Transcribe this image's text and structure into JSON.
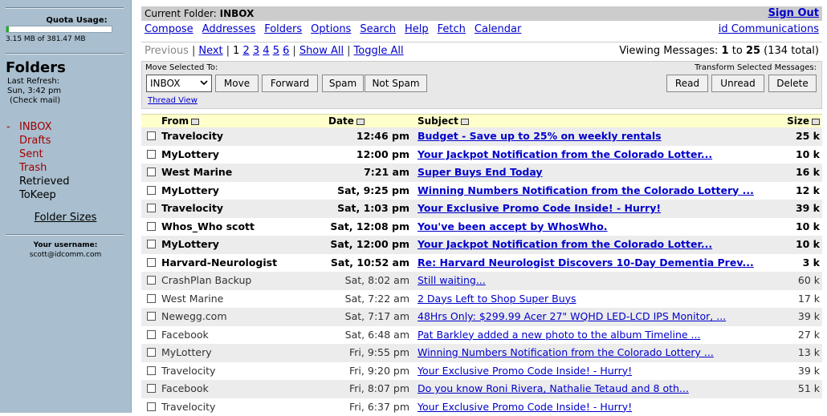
{
  "sidebar": {
    "quota_title": "Quota Usage:",
    "quota_text": "3.15 MB of 381.47 MB",
    "quota_fraction": 0.008,
    "folders_title": "Folders",
    "refresh_label": "Last Refresh:",
    "refresh_time": "Sun, 3:42 pm",
    "check_mail": "(Check mail)",
    "folders": [
      "INBOX",
      "Drafts",
      "Sent",
      "Trash",
      "Retrieved",
      "ToKeep"
    ],
    "folder_sizes": "Folder Sizes",
    "user_label": "Your username:",
    "user_email": "scott@idcomm.com"
  },
  "header": {
    "current_folder_label": "Current Folder:",
    "current_folder": "INBOX",
    "sign_out": "Sign Out"
  },
  "nav": {
    "items": [
      "Compose",
      "Addresses",
      "Folders",
      "Options",
      "Search",
      "Help",
      "Fetch",
      "Calendar"
    ],
    "org": "id Communications"
  },
  "pager": {
    "previous": "Previous",
    "next": "Next",
    "current_page": "1",
    "pages": [
      "2",
      "3",
      "4",
      "5",
      "6"
    ],
    "show_all": "Show All",
    "toggle_all": "Toggle All",
    "viewing_prefix": "Viewing Messages:",
    "viewing_from": "1",
    "viewing_to_word": "to",
    "viewing_to": "25",
    "viewing_total": "(134 total)"
  },
  "actions": {
    "move_label": "Move Selected To:",
    "transform_label": "Transform Selected Messages:",
    "selected_folder": "INBOX",
    "move": "Move",
    "forward": "Forward",
    "spam": "Spam",
    "not_spam": "Not Spam",
    "read": "Read",
    "unread": "Unread",
    "delete": "Delete",
    "thread_view": "Thread View"
  },
  "table": {
    "headers": {
      "from": "From",
      "date": "Date",
      "subject": "Subject",
      "size": "Size"
    },
    "rows": [
      {
        "from": "Travelocity",
        "date": "12:46 pm",
        "subject": "Budget - Save up to 25% on weekly rentals",
        "size": "25 k",
        "unread": true
      },
      {
        "from": "MyLottery",
        "date": "12:00 pm",
        "subject": "Your Jackpot Notification from the Colorado Lotter...",
        "size": "10 k",
        "unread": true
      },
      {
        "from": "West Marine",
        "date": "7:21 am",
        "subject": "Super Buys End Today",
        "size": "16 k",
        "unread": true
      },
      {
        "from": "MyLottery",
        "date": "Sat, 9:25 pm",
        "subject": "Winning Numbers Notification from the Colorado Lottery ...",
        "size": "12 k",
        "unread": true
      },
      {
        "from": "Travelocity",
        "date": "Sat, 1:03 pm",
        "subject": "Your Exclusive Promo Code Inside! - Hurry!",
        "size": "39 k",
        "unread": true
      },
      {
        "from": "Whos_Who scott",
        "date": "Sat, 12:08 pm",
        "subject": "You've been accept by WhosWho.",
        "size": "10 k",
        "unread": true
      },
      {
        "from": "MyLottery",
        "date": "Sat, 12:00 pm",
        "subject": "Your Jackpot Notification from the Colorado Lotter...",
        "size": "10 k",
        "unread": true
      },
      {
        "from": "Harvard-Neurologist",
        "date": "Sat, 10:52 am",
        "subject": "Re: Harvard Neurologist Discovers 10-Day Dementia Prev...",
        "size": "3 k",
        "unread": true
      },
      {
        "from": "CrashPlan Backup",
        "date": "Sat, 8:02 am",
        "subject": "Still waiting...",
        "size": "60 k",
        "unread": false
      },
      {
        "from": "West Marine",
        "date": "Sat, 7:22 am",
        "subject": "2 Days Left to Shop Super Buys",
        "size": "17 k",
        "unread": false
      },
      {
        "from": "Newegg.com",
        "date": "Sat, 7:17 am",
        "subject": "48Hrs Only: $299.99 Acer 27\" WQHD LED-LCD IPS Monitor, ...",
        "size": "39 k",
        "unread": false
      },
      {
        "from": "Facebook",
        "date": "Sat, 6:48 am",
        "subject": "Pat Barkley added a new photo to the album Timeline ...",
        "size": "27 k",
        "unread": false
      },
      {
        "from": "MyLottery",
        "date": "Fri, 9:55 pm",
        "subject": "Winning Numbers Notification from the Colorado Lottery ...",
        "size": "13 k",
        "unread": false
      },
      {
        "from": "Travelocity",
        "date": "Fri, 9:20 pm",
        "subject": "Your Exclusive Promo Code Inside! - Hurry!",
        "size": "39 k",
        "unread": false
      },
      {
        "from": "Facebook",
        "date": "Fri, 8:07 pm",
        "subject": "Do you know Roni Rivera, Nathalie Tetaud and 8 oth...",
        "size": "51 k",
        "unread": false
      },
      {
        "from": "Travelocity",
        "date": "Fri, 6:37 pm",
        "subject": "Your Exclusive Promo Code Inside! - Hurry!",
        "size": "",
        "unread": false
      }
    ]
  }
}
